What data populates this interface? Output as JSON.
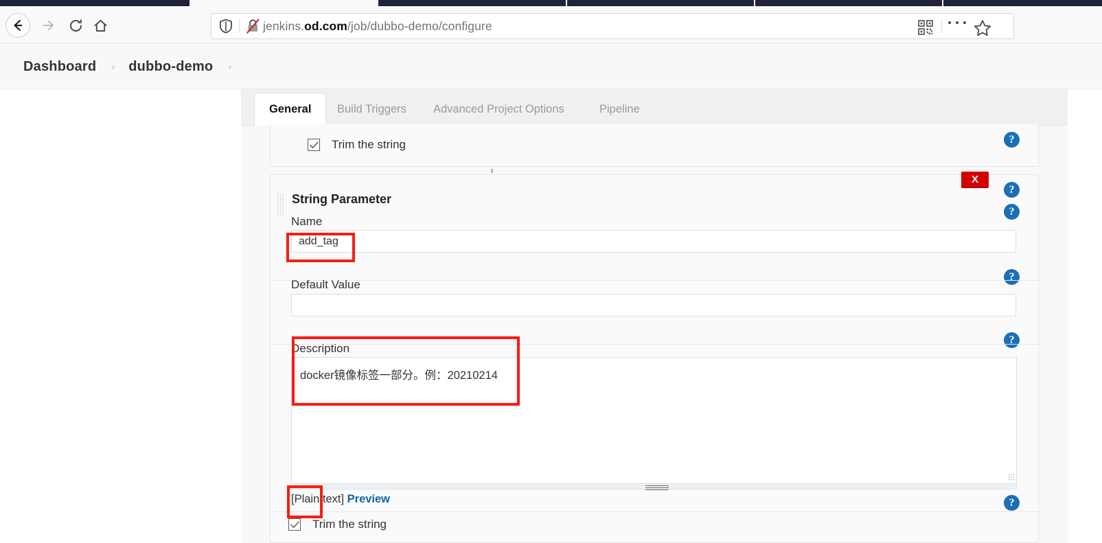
{
  "browser": {
    "nav": {
      "back_label": "Back",
      "forward_label": "Forward",
      "reload_label": "Reload",
      "home_label": "Home"
    },
    "urlbar": {
      "url_prefix": "jenkins.",
      "url_domain": "od.com",
      "url_suffix": "/job/dubbo-demo/configure",
      "full_url": "jenkins.od.com/job/dubbo-demo/configure",
      "shield_icon": "shield-icon",
      "insecure_icon": "crossed-lock-icon"
    },
    "actions": {
      "qr_label": "QR code",
      "menu_label": "Open application menu",
      "bookmark_label": "Bookmark this page"
    }
  },
  "breadcrumb": {
    "items": [
      {
        "label": "Dashboard"
      },
      {
        "label": "dubbo-demo"
      }
    ],
    "separator": "›"
  },
  "config": {
    "tabs": [
      {
        "label": "General",
        "active": true
      },
      {
        "label": "Build Triggers",
        "active": false
      },
      {
        "label": "Advanced Project Options",
        "active": false
      },
      {
        "label": "Pipeline",
        "active": false
      }
    ],
    "previous_parameter": {
      "trim_label": "Trim the string",
      "trim_checked": true
    },
    "string_parameter": {
      "title": "String Parameter",
      "delete_label": "X",
      "name_label": "Name",
      "name_value": "add_tag",
      "default_value_label": "Default Value",
      "default_value": "",
      "description_label": "Description",
      "description_value": "docker镜像标签一部分。例：20210214",
      "markup_note": "[Plain text]",
      "preview_link": "Preview",
      "trim_label": "Trim the string",
      "trim_checked": true
    },
    "help_icon_label": "?",
    "accent_color": "#1a6fb5",
    "delete_color": "#d40000",
    "annotation_color": "#f71e0f"
  }
}
